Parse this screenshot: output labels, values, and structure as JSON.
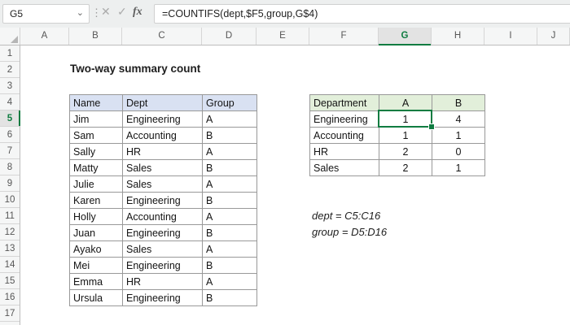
{
  "formula_bar": {
    "name_box": "G5",
    "formula": "=COUNTIFS(dept,$F5,group,G$4)",
    "cancel_glyph": "✕",
    "enter_glyph": "✓",
    "fx_label": "fx"
  },
  "sheet": {
    "title": "Two-way summary count",
    "column_headers": [
      "A",
      "B",
      "C",
      "D",
      "E",
      "F",
      "G",
      "H",
      "I",
      "J"
    ],
    "row_numbers": [
      1,
      2,
      3,
      4,
      5,
      6,
      7,
      8,
      9,
      10,
      11,
      12,
      13,
      14,
      15,
      16,
      17
    ],
    "selected_column": "G",
    "selected_row": 5,
    "selected_cell": {
      "ref": "G5",
      "value": "1"
    },
    "data_table": {
      "headers": [
        "Name",
        "Dept",
        "Group"
      ],
      "rows": [
        [
          "Jim",
          "Engineering",
          "A"
        ],
        [
          "Sam",
          "Accounting",
          "B"
        ],
        [
          "Sally",
          "HR",
          "A"
        ],
        [
          "Matty",
          "Sales",
          "B"
        ],
        [
          "Julie",
          "Sales",
          "A"
        ],
        [
          "Karen",
          "Engineering",
          "B"
        ],
        [
          "Holly",
          "Accounting",
          "A"
        ],
        [
          "Juan",
          "Engineering",
          "B"
        ],
        [
          "Ayako",
          "Sales",
          "A"
        ],
        [
          "Mei",
          "Engineering",
          "B"
        ],
        [
          "Emma",
          "HR",
          "A"
        ],
        [
          "Ursula",
          "Engineering",
          "B"
        ]
      ]
    },
    "summary_table": {
      "headers": [
        "Department",
        "A",
        "B"
      ],
      "rows": [
        [
          "Engineering",
          "1",
          "4"
        ],
        [
          "Accounting",
          "1",
          "1"
        ],
        [
          "HR",
          "2",
          "0"
        ],
        [
          "Sales",
          "2",
          "1"
        ]
      ]
    },
    "annotations": [
      "dept = C5:C16",
      "group = D5:D16"
    ]
  },
  "colors": {
    "selection_green": "#107C41",
    "data_header_fill": "#D9E1F2",
    "summary_header_fill": "#E2EFDA",
    "table_border": "#999999",
    "header_strip": "#f5f6f6"
  }
}
